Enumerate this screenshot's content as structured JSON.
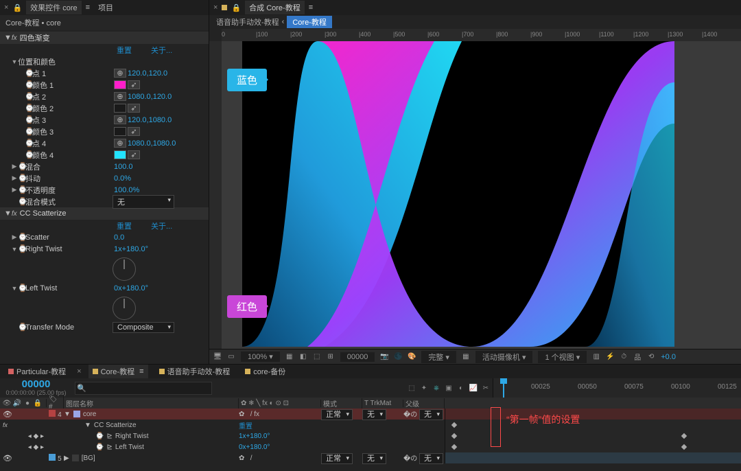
{
  "effects": {
    "tab_active": "效果控件 core",
    "tab_other": "项目",
    "context": "Core-教程 • core",
    "eff1": {
      "name": "四色渐变",
      "reset": "重置",
      "about": "关于...",
      "group_pos": "位置和颜色",
      "pt1": "点 1",
      "pt1_val": "120.0,120.0",
      "col1": "颜色 1",
      "pt2": "点 2",
      "pt2_val": "1080.0,120.0",
      "col2": "颜色 2",
      "pt3": "点 3",
      "pt3_val": "120.0,1080.0",
      "col3": "颜色 3",
      "pt4": "点 4",
      "pt4_val": "1080.0,1080.0",
      "col4": "颜色 4",
      "blend": "混合",
      "blend_val": "100.0",
      "jitter": "抖动",
      "jitter_val": "0.0%",
      "opacity": "不透明度",
      "opacity_val": "100.0%",
      "mode": "混合模式",
      "mode_val": "无"
    },
    "eff2": {
      "name": "CC Scatterize",
      "reset": "重置",
      "about": "关于...",
      "scatter": "Scatter",
      "scatter_val": "0.0",
      "rt": "Right Twist",
      "rt_val": "1x+180.0°",
      "lt": "Left Twist",
      "lt_val": "0x+180.0°",
      "tm": "Transfer Mode",
      "tm_val": "Composite"
    }
  },
  "viewer": {
    "tab": "合成 Core-教程",
    "bc1": "语音助手动效-教程",
    "bc2": "Core-教程",
    "tag_blue": "蓝色",
    "tag_red": "红色",
    "footer": {
      "zoom": "100%",
      "frame": "00000",
      "res": "完整",
      "cam": "活动摄像机",
      "views": "1 个视图",
      "expo": "+0.0"
    },
    "ruler_ticks": [
      "0",
      "|100",
      "|200",
      "|300",
      "|400",
      "|500",
      "|600",
      "|700",
      "|800",
      "|900",
      "|1000",
      "|1100",
      "|1200",
      "|1300",
      "|1400"
    ]
  },
  "timeline": {
    "tabs": {
      "t1": "Particular-教程",
      "t2": "Core-教程",
      "t3": "语音助手动效-教程",
      "t4": "core-备份"
    },
    "time_big": "00000",
    "time_small": "0:00:00:00 (25.00 fps)",
    "time_ticks": [
      "00025",
      "00050",
      "00075",
      "00100",
      "00125"
    ],
    "colhead": {
      "layer": "图层名称",
      "mode": "模式",
      "trk": "T TrkMat",
      "parent": "父级"
    },
    "row4": {
      "num": "4",
      "name": "core",
      "mode": "正常",
      "trk": "无",
      "parent": "无",
      "eff": "CC Scatterize",
      "reset": "重置",
      "rt": "Right Twist",
      "rt_val": "1x+180.0°",
      "lt": "Left Twist",
      "lt_val": "0x+180.0°"
    },
    "row5": {
      "num": "5",
      "name": "[BG]",
      "mode": "正常",
      "trk": "无",
      "parent": "无"
    },
    "annot": "“第一帧”值的设置"
  },
  "colors": {
    "col1": "#ff1ecb",
    "col2": "#1a1a1a",
    "col3": "#1a1a1a",
    "col4": "#22e3ff",
    "tab1": "#d46262",
    "tab2": "#d6b25a",
    "tab3": "#d6b25a",
    "tab4": "#d6b25a",
    "layer4": "#b54242",
    "layer5": "#4a9dd6",
    "coresq": "#9aa6e6",
    "bgsq": "#3a3a3a"
  }
}
